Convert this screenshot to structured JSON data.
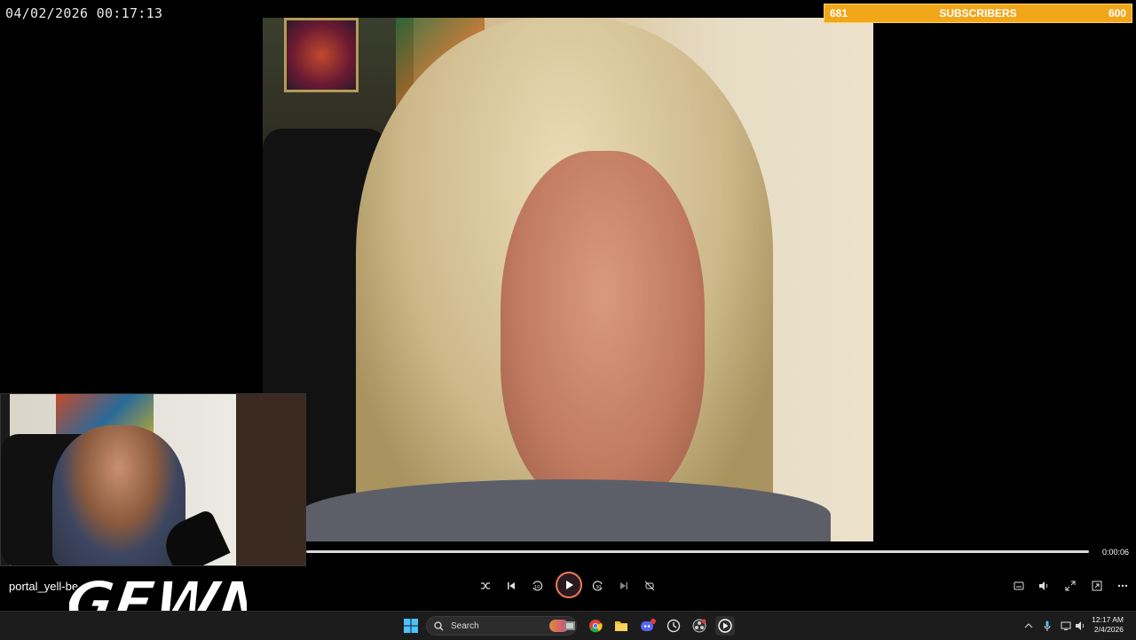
{
  "overlay": {
    "timestamp": "04/02/2026 00:17:13",
    "subscribers": {
      "current": "681",
      "label": "SUBSCRIBERS",
      "goal": "600",
      "color": "#f2a71b"
    }
  },
  "webcam": {
    "username": "portal_yell-be",
    "logo_text": "GEWN"
  },
  "player": {
    "time_display": "0:00:06",
    "progress_fraction": 0.0,
    "accent": "#f07a5a",
    "controls": [
      "shuffle-icon",
      "previous-icon",
      "rewind-10-icon",
      "play-icon",
      "forward-30-icon",
      "next-icon",
      "repeat-off-icon"
    ],
    "right_controls": [
      "subtitles-icon",
      "volume-icon",
      "fullscreen-icon",
      "miniplayer-icon",
      "more-icon"
    ]
  },
  "taskbar": {
    "search_label": "Search",
    "apps": [
      "windows-start-icon",
      "search-icon",
      "files-icon",
      "task-view-icon",
      "chrome-icon",
      "file-explorer-icon",
      "discord-icon",
      "clock-icon",
      "obs-icon",
      "media-player-icon"
    ],
    "time": "12:17 AM",
    "date": "2/4/2026"
  }
}
